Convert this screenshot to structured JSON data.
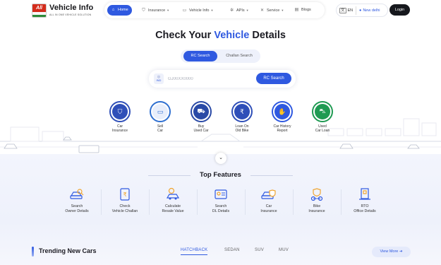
{
  "brand": {
    "name": "Vehicle Info",
    "tagline": "ALL IN ONE VEHICLE SOLUTION",
    "badge_text": "All"
  },
  "nav": {
    "items": [
      {
        "label": "Home",
        "icon": "home-icon",
        "active": true
      },
      {
        "label": "Insurance",
        "icon": "shield-icon",
        "dropdown": true
      },
      {
        "label": "Vehicle Info",
        "icon": "car-icon",
        "dropdown": true
      },
      {
        "label": "APIs",
        "icon": "api-icon",
        "dropdown": true
      },
      {
        "label": "Service",
        "icon": "wrench-icon",
        "dropdown": true
      },
      {
        "label": "Blogs",
        "icon": "document-icon"
      }
    ],
    "language": "EN",
    "location": "New delhi",
    "login_label": "Login"
  },
  "hero": {
    "title_prefix": "Check Your",
    "title_highlight": "Vehicle",
    "title_suffix": "Details",
    "tabs": [
      "RC Search",
      "Challan Search"
    ],
    "active_tab": "RC Search",
    "country_code": "IND",
    "search_placeholder": "GJ00XX0000",
    "search_value": "",
    "search_button": "RC Search"
  },
  "services": [
    {
      "line1": "Car",
      "line2": "Insurance",
      "icon": "car-insurance-icon",
      "color": "#2f4fb8"
    },
    {
      "line1": "Sell",
      "line2": "Car",
      "icon": "sell-car-icon",
      "color": "#2f6fd0"
    },
    {
      "line1": "Buy",
      "line2": "Used Car",
      "icon": "buy-car-icon",
      "color": "#2a4aa6"
    },
    {
      "line1": "Loan On",
      "line2": "Old Bike",
      "icon": "bike-loan-icon",
      "color": "#2f4fb8"
    },
    {
      "line1": "Car History",
      "line2": "Report",
      "icon": "history-report-icon",
      "color": "#2f59e0"
    },
    {
      "line1": "Used",
      "line2": "Car Loan",
      "icon": "car-loan-icon",
      "color": "#1f9a52"
    }
  ],
  "features": {
    "title": "Top Features",
    "items": [
      {
        "line1": "Search",
        "line2": "Owner Details",
        "icon": "owner-search-icon"
      },
      {
        "line1": "Check",
        "line2": "Vehicle Challan",
        "icon": "challan-icon"
      },
      {
        "line1": "Calculate",
        "line2": "Resale Value",
        "icon": "resale-value-icon"
      },
      {
        "line1": "Search",
        "line2": "DL Details",
        "icon": "driving-license-icon"
      },
      {
        "line1": "Car",
        "line2": "Insurance",
        "icon": "car-insurance-outline-icon"
      },
      {
        "line1": "Bike",
        "line2": "Insurance",
        "icon": "bike-insurance-icon"
      },
      {
        "line1": "RTO",
        "line2": "Office Details",
        "icon": "rto-office-icon"
      }
    ]
  },
  "trending": {
    "title": "Trending New Cars",
    "tabs": [
      "HATCHBACK",
      "SEDAN",
      "SUV",
      "MUV"
    ],
    "active_tab": "HATCHBACK",
    "view_more": "View More"
  },
  "colors": {
    "accent": "#2f59e0",
    "dark": "#16181d",
    "feature_icon": "#2f59e0",
    "feature_icon_accent": "#f0a531"
  }
}
